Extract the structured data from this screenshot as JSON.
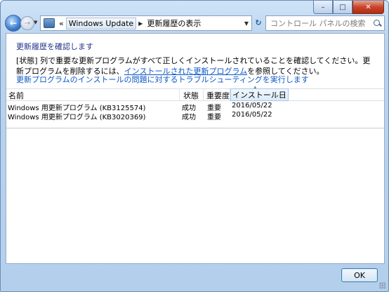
{
  "window": {
    "controls": {
      "minimize": "–",
      "maximize": "□",
      "close": "✕"
    }
  },
  "navigation": {
    "back_icon": "back-arrow-icon",
    "forward_icon": "forward-arrow-icon",
    "breadcrumb": {
      "overflow": "«",
      "items": [
        "Windows Update",
        "更新履歴の表示"
      ]
    },
    "search_placeholder": "コントロール パネルの検索"
  },
  "content": {
    "heading": "更新履歴を確認します",
    "description_before_link": "[状態] 列で重要な更新プログラムがすべて正しくインストールされていることを確認してください。更新プログラムを削除するには、",
    "description_link": "インストールされた更新プログラム",
    "description_after_link": "を参照してください。",
    "troubleshoot_link": "更新プログラムのインストールの問題に対するトラブルシューティングを実行します"
  },
  "table": {
    "columns": [
      "名前",
      "状態",
      "重要度",
      "インストール日"
    ],
    "sorted_column": "インストール日",
    "rows": [
      {
        "name": "Windows 用更新プログラム (KB3125574)",
        "status": "成功",
        "importance": "重要",
        "date": "2016/05/22"
      },
      {
        "name": "Windows 用更新プログラム (KB3020369)",
        "status": "成功",
        "importance": "重要",
        "date": "2016/05/22"
      }
    ]
  },
  "footer": {
    "ok_label": "OK"
  }
}
